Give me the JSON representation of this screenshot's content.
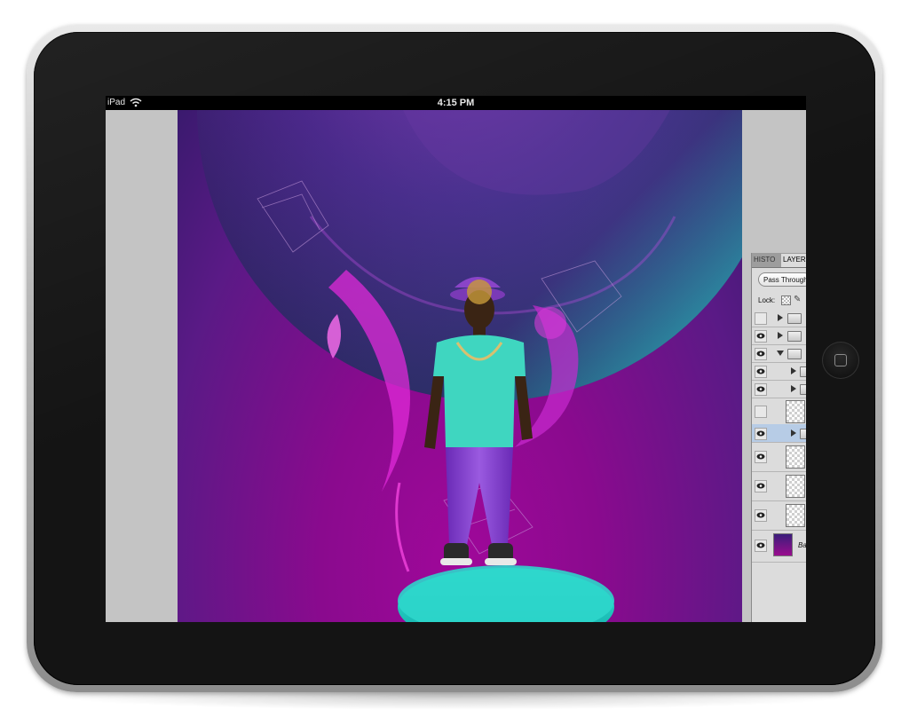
{
  "status_bar": {
    "carrier": "iPad",
    "time": "4:15 PM"
  },
  "layers_panel": {
    "tabs": [
      "HISTO",
      "LAYER"
    ],
    "blend_mode": "Pass Through",
    "lock_label": "Lock:",
    "layers": [
      {
        "visible": false,
        "kind": "group",
        "expanded": false,
        "indent": 0
      },
      {
        "visible": true,
        "kind": "group",
        "expanded": false,
        "indent": 0
      },
      {
        "visible": true,
        "kind": "group",
        "expanded": true,
        "indent": 0
      },
      {
        "visible": true,
        "kind": "group",
        "expanded": false,
        "indent": 1
      },
      {
        "visible": true,
        "kind": "group",
        "expanded": false,
        "indent": 1
      },
      {
        "visible": false,
        "kind": "layer",
        "indent": 1
      },
      {
        "visible": true,
        "kind": "group",
        "expanded": false,
        "indent": 1,
        "selected": true
      },
      {
        "visible": true,
        "kind": "layer",
        "indent": 1
      },
      {
        "visible": true,
        "kind": "layer",
        "indent": 1
      },
      {
        "visible": true,
        "kind": "layer",
        "indent": 1
      },
      {
        "visible": true,
        "kind": "background",
        "name": "Ba"
      }
    ]
  },
  "colors": {
    "canvas_purple": "#8a0a8e",
    "sphere_dark": "#3d1468",
    "platform_teal": "#22c9c0",
    "shirt_teal": "#3fd6c0",
    "pasteboard": "#c4c4c4",
    "bezel": "#141414"
  }
}
